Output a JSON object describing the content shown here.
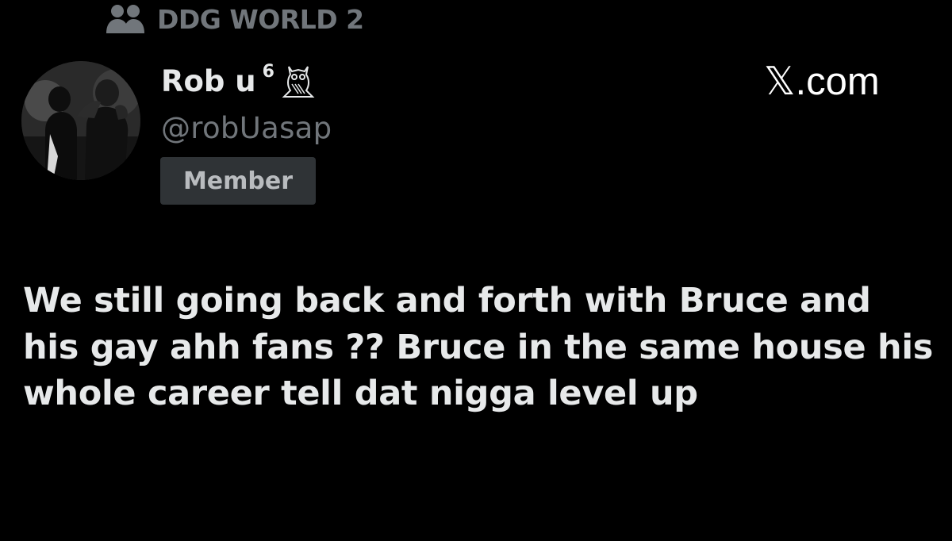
{
  "community": {
    "icon": "people-icon",
    "name": "DDG WORLD 2"
  },
  "author": {
    "avatar": "avatar",
    "display_name": "Rob u",
    "superscript": "6",
    "emoji_icon": "owl-icon",
    "handle": "@robUasap",
    "badge": "Member"
  },
  "watermark": {
    "site": "𝕏.com"
  },
  "post": {
    "text": "We still going back and forth with Bruce and his gay ahh fans ?? Bruce in the same house his whole career tell dat nigga level up"
  },
  "colors": {
    "background": "#000000",
    "primary_text": "#e7e9ea",
    "secondary_text": "#71767b",
    "badge_bg": "#2f3336"
  }
}
